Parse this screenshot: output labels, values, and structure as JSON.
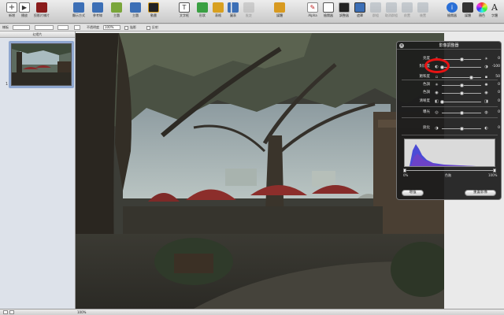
{
  "toolbar": {
    "items": [
      {
        "label": "新增",
        "icon": "plus-icon",
        "color": "#4a4a4a"
      },
      {
        "label": "播放",
        "icon": "play-icon",
        "color": "#4a4a4a"
      },
      {
        "label": "投影片樣片",
        "icon": "master-slide-icon",
        "color": "#8a1b1b"
      },
      {
        "label": "顯示方式",
        "icon": "view-icon",
        "color": "#3c6fb6"
      },
      {
        "label": "參考線",
        "icon": "guides-icon",
        "color": "#3c6fb6"
      },
      {
        "label": "主題",
        "icon": "themes-icon",
        "color": "#7aa63a"
      },
      {
        "label": "主題",
        "icon": "masters-icon",
        "color": "#3c6fb6"
      },
      {
        "label": "動畫",
        "icon": "animation-icon",
        "color": "#222222"
      },
      {
        "label": "文字框",
        "icon": "textbox-icon",
        "color": "#555555"
      },
      {
        "label": "形狀",
        "icon": "shapes-icon",
        "color": "#3aa043"
      },
      {
        "label": "表格",
        "icon": "table-icon",
        "color": "#d8a020"
      },
      {
        "label": "圖表",
        "icon": "chart-icon",
        "color": "#3c6fb6"
      },
      {
        "label": "批註",
        "icon": "comment-icon",
        "color": "#888888"
      },
      {
        "label": "媒體",
        "icon": "media-icon",
        "color": "#d89a20"
      },
      {
        "label": "Alpha",
        "icon": "alpha-icon",
        "color": "#c02020"
      },
      {
        "label": "檢閱器",
        "icon": "inspector-icon",
        "color": "#333333"
      },
      {
        "label": "調整器",
        "icon": "adjust-icon",
        "color": "#222222"
      },
      {
        "label": "遮罩",
        "icon": "mask-icon",
        "color": "#3c6fb6"
      },
      {
        "label": "群組",
        "icon": "group-icon",
        "color": "#9aa4b0"
      },
      {
        "label": "取消群組",
        "icon": "ungroup-icon",
        "color": "#9aa4b0"
      },
      {
        "label": "前置",
        "icon": "front-icon",
        "color": "#9aa4b0"
      },
      {
        "label": "後置",
        "icon": "back-icon",
        "color": "#9aa4b0"
      },
      {
        "label": "檢閱器",
        "icon": "info-icon",
        "color": "#2a6fd6"
      },
      {
        "label": "媒體",
        "icon": "media-browser-icon",
        "color": "#333333"
      },
      {
        "label": "顏色",
        "icon": "color-wheel-icon",
        "color": "#d04080"
      },
      {
        "label": "字體",
        "icon": "fonts-icon",
        "color": "#222222"
      }
    ]
  },
  "formatbar": {
    "style_label": "樣板",
    "opacity_label": "不透明度",
    "opacity_value": "100%",
    "shadow_label": "陰影",
    "reflection_label": "反射"
  },
  "sidebar": {
    "header": "幻燈片",
    "slide_number": "1"
  },
  "statusbar": {
    "zoom": "100%"
  },
  "adjust_panel": {
    "title": "影像調整器",
    "rows": [
      {
        "label": "亮度",
        "value": "0",
        "knob": 0.5,
        "icon_l": "☼",
        "icon_r": "☀"
      },
      {
        "label": "對比度",
        "value": "-100",
        "knob": 0.0,
        "icon_l": "◐",
        "icon_r": "◑"
      },
      {
        "label": "飽和度",
        "value": "50",
        "knob": 0.75,
        "icon_l": "▫",
        "icon_r": "▪"
      },
      {
        "label": "色調",
        "value": "0",
        "knob": 0.5,
        "icon_l": "✳",
        "icon_r": "✺"
      },
      {
        "label": "色調",
        "value": "0",
        "knob": 0.5,
        "icon_l": "◉",
        "icon_r": "◉"
      },
      {
        "label": "清晰度",
        "value": "0",
        "knob": 0.0,
        "icon_l": "◧",
        "icon_r": "◨"
      },
      {
        "label": "曝光",
        "value": "0",
        "knob": 0.5,
        "icon_l": "◎",
        "icon_r": "◍"
      },
      {
        "label": "銳化",
        "value": "0",
        "knob": 0.5,
        "icon_l": "◑",
        "icon_r": "◐"
      }
    ],
    "histogram_left_label": "0%",
    "histogram_mid_label": "色階",
    "histogram_right_label": "100%",
    "auto_button": "增強",
    "reset_button": "重置影像"
  },
  "colors": {
    "highlight": "#e81313",
    "panel_bg": "#1c1c1c",
    "sidebar_selection": "#8fa7cf"
  }
}
